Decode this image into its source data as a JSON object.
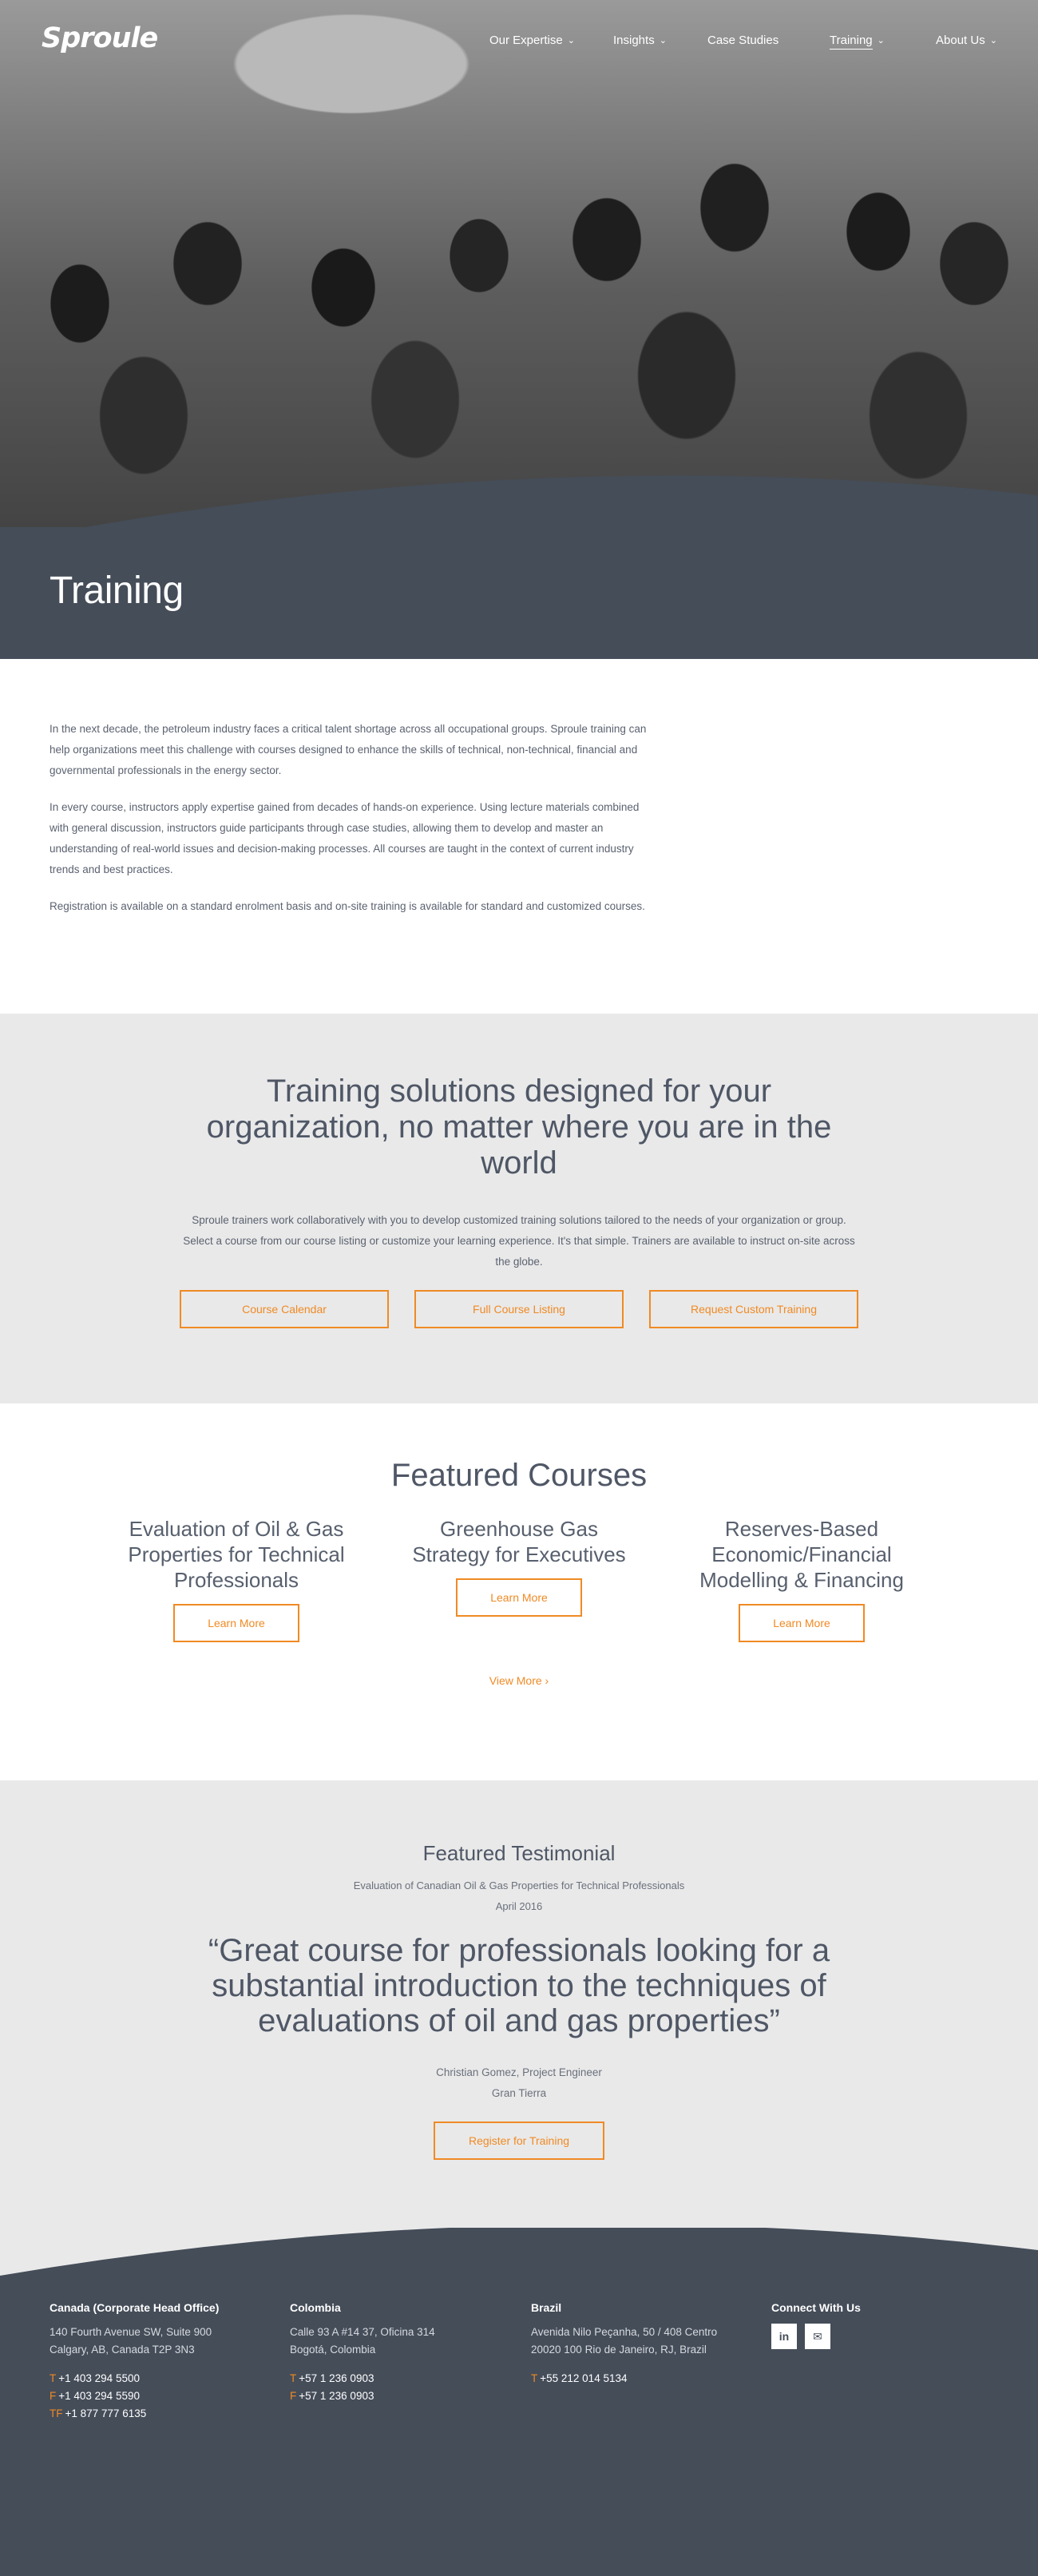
{
  "brand": {
    "logo": "Sproule",
    "accent": "#f08a24",
    "dark": "#454d59"
  },
  "nav": {
    "items": [
      {
        "label": "Our Expertise",
        "has_dropdown": true
      },
      {
        "label": "Insights",
        "has_dropdown": true
      },
      {
        "label": "Case Studies",
        "has_dropdown": false
      },
      {
        "label": "Training",
        "has_dropdown": true,
        "active": true
      },
      {
        "label": "About Us",
        "has_dropdown": true
      }
    ],
    "chevron": "⌄"
  },
  "hero": {
    "title": "Training"
  },
  "intro": {
    "paragraphs": [
      "In the next decade, the petroleum industry faces a critical talent shortage across all occupational groups. Sproule training can help organizations meet this challenge with courses designed to enhance the skills of technical, non-technical, financial and governmental professionals in the energy sector.",
      "In every course, instructors apply expertise gained from decades of hands-on experience. Using lecture materials combined with general discussion, instructors guide participants through case studies, allowing them to develop and master an understanding of real-world issues and decision-making processes. All courses are taught in the context of current industry trends and best practices.",
      "Registration is available on a standard enrolment basis and on-site training is available for standard and customized courses."
    ]
  },
  "solutions": {
    "heading": "Training solutions designed for your organization, no matter where you are in the world",
    "description": "Sproule trainers work collaboratively with you to develop customized training solutions tailored to the needs of your organization or group. Select a course from our course listing or customize your learning experience. It's that simple. Trainers are available to instruct on-site across the globe.",
    "buttons": [
      "Course Calendar",
      "Full Course Listing",
      "Request Custom Training"
    ]
  },
  "featured_courses": {
    "heading": "Featured Courses",
    "courses": [
      {
        "title": "Evaluation of Oil & Gas Properties for Technical Professionals",
        "cta": "Learn More"
      },
      {
        "title": "Greenhouse Gas Strategy for Executives",
        "cta": "Learn More"
      },
      {
        "title": "Reserves-Based Economic/Financial Modelling & Financing",
        "cta": "Learn More"
      }
    ],
    "view_more": "View More",
    "view_more_icon": "›"
  },
  "testimonial": {
    "heading": "Featured Testimonial",
    "course": "Evaluation of Canadian Oil & Gas Properties for Technical Professionals",
    "date": "April 2016",
    "quote": "“Great course for professionals looking for a substantial introduction to the techniques of evaluations of oil and gas properties”",
    "author": "Christian Gomez, Project Engineer",
    "company": "Gran Tierra",
    "cta": "Register for Training"
  },
  "footer": {
    "offices": [
      {
        "name": "Canada (Corporate Head Office)",
        "address": [
          "140 Fourth Avenue SW, Suite 900",
          "Calgary, AB, Canada T2P 3N3"
        ],
        "phones": [
          {
            "prefix": "T",
            "number": "+1 403 294 5500"
          },
          {
            "prefix": "F",
            "number": "+1 403 294 5590"
          },
          {
            "prefix": "TF",
            "number": "+1 877 777 6135"
          }
        ]
      },
      {
        "name": "Colombia",
        "address": [
          "Calle 93 A #14 37, Oficina 314",
          "Bogotá, Colombia"
        ],
        "phones": [
          {
            "prefix": "T",
            "number": "+57 1 236 0903"
          },
          {
            "prefix": "F",
            "number": "+57 1 236 0903"
          }
        ]
      },
      {
        "name": "Brazil",
        "address": [
          "Avenida Nilo Peçanha, 50 / 408 Centro",
          "20020 100 Rio de Janeiro, RJ, Brazil"
        ],
        "phones": [
          {
            "prefix": "T",
            "number": "+55 212 014 5134"
          }
        ]
      }
    ],
    "connect": {
      "heading": "Connect With Us",
      "icons": [
        {
          "name": "linkedin-icon",
          "glyph": "in"
        },
        {
          "name": "email-icon",
          "glyph": "✉"
        }
      ]
    }
  }
}
